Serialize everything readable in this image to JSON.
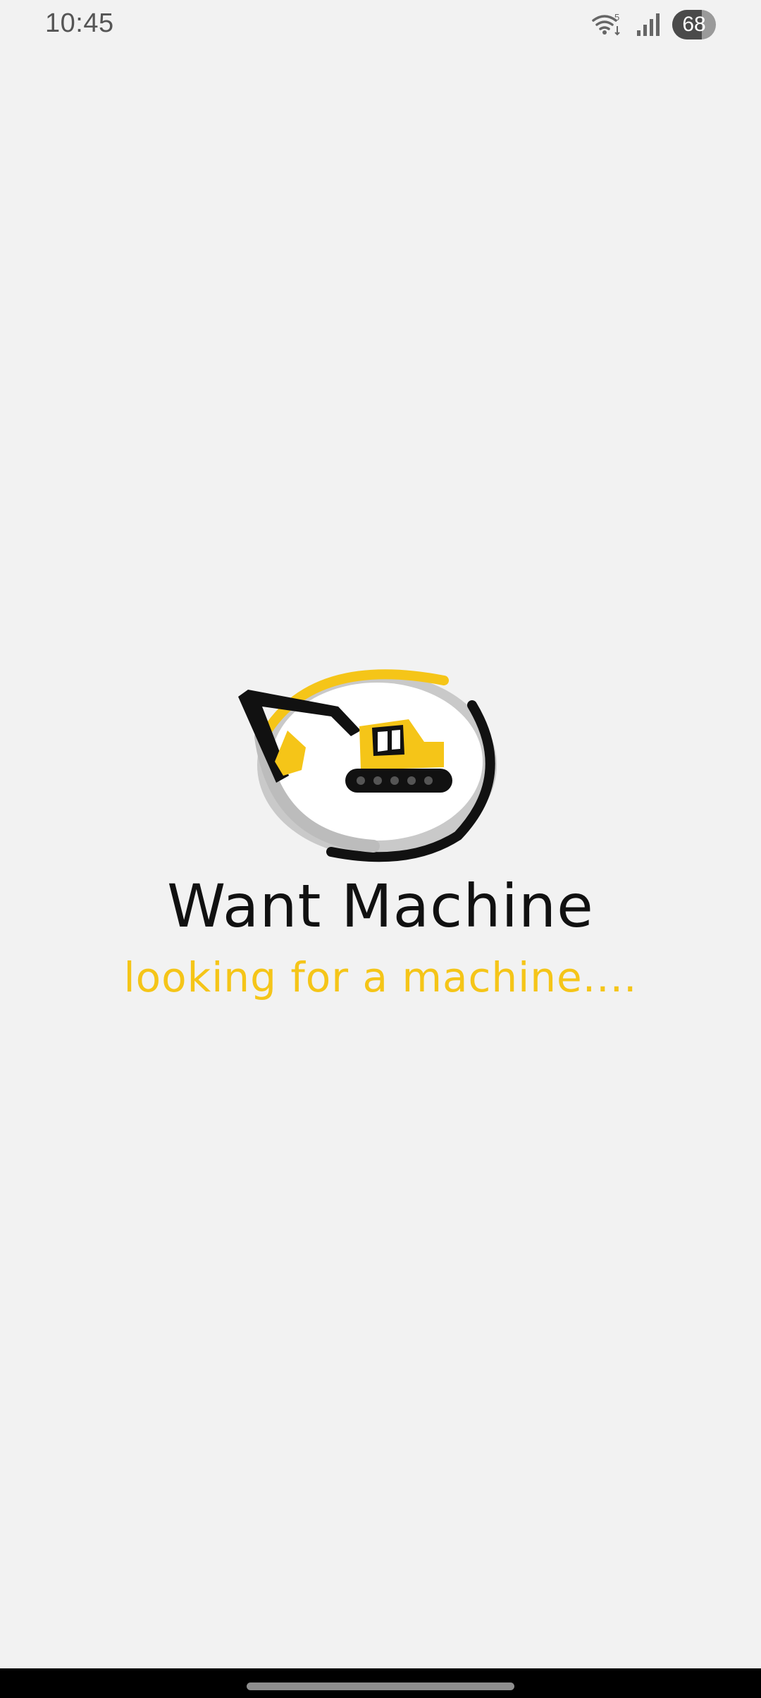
{
  "status_bar": {
    "time": "10:45",
    "wifi_badge": "5",
    "battery_level": "68",
    "battery_fraction": 0.68
  },
  "splash": {
    "app_name": "Want Machine",
    "tagline": "looking for a machine....",
    "colors": {
      "brand_yellow": "#f5c518",
      "text_dark": "#111111",
      "background": "#f2f2f2"
    }
  },
  "icons": [
    "wifi-icon",
    "signal-icon",
    "battery-icon",
    "excavator-logo-icon"
  ]
}
